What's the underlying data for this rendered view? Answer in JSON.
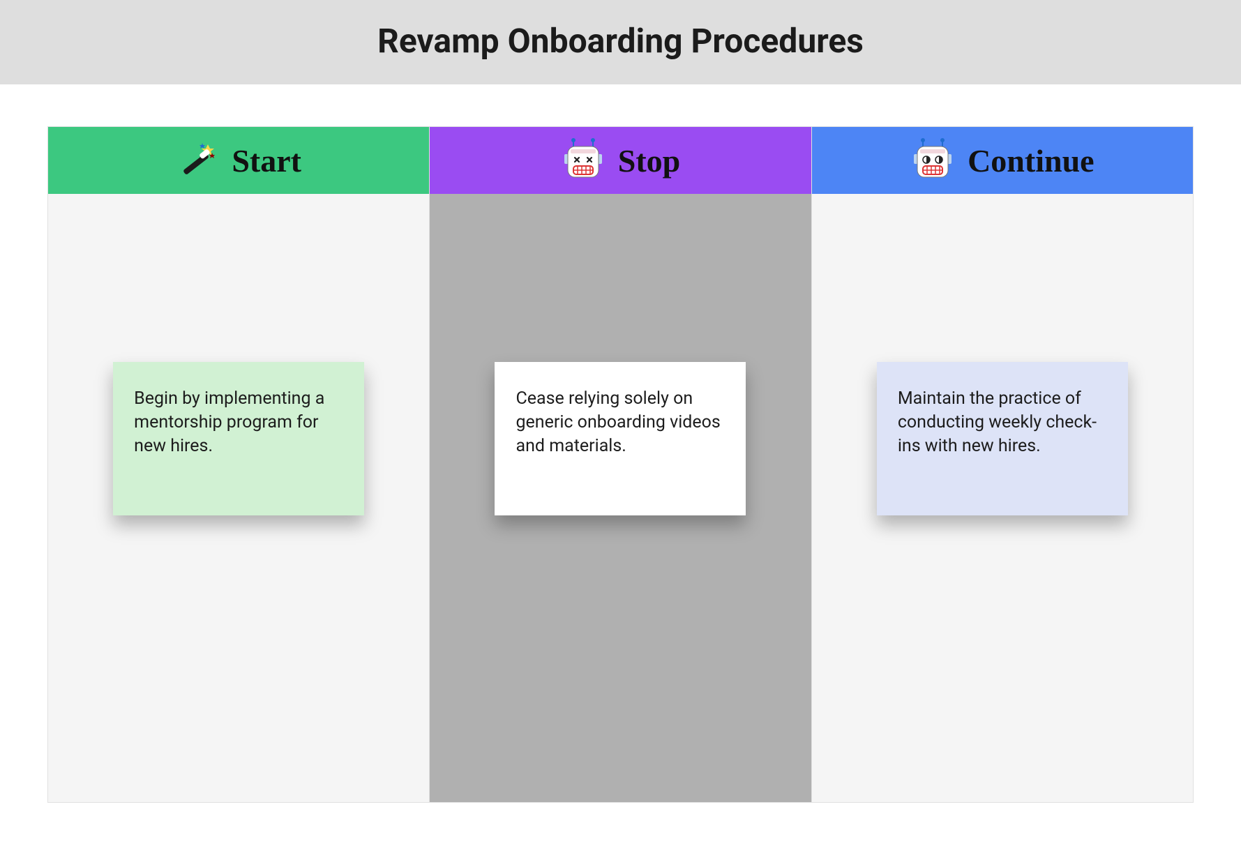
{
  "header": {
    "title": "Revamp Onboarding Procedures"
  },
  "columns": {
    "start": {
      "label": "Start",
      "header_color": "#3cc880",
      "card": {
        "text": "Begin by implementing a mentorship program for new hires.",
        "bg": "#d1f1d3"
      }
    },
    "stop": {
      "label": "Stop",
      "header_color": "#9a4cf2",
      "card": {
        "text": "Cease relying solely on generic onboarding videos and materials.",
        "bg": "#ffffff"
      }
    },
    "continue": {
      "label": "Continue",
      "header_color": "#4d85f5",
      "card": {
        "text": "Maintain the practice of conducting weekly check-ins with new hires.",
        "bg": "#dde3f7"
      }
    }
  }
}
